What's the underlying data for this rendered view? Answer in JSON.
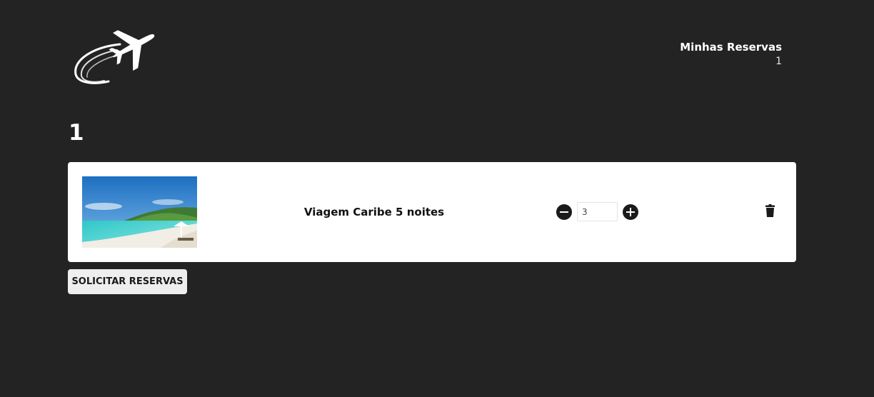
{
  "header": {
    "cart_title": "Minhas Reservas",
    "cart_count": "1"
  },
  "page": {
    "title": "1"
  },
  "products": [
    {
      "image": "caribbean-beach-photo",
      "name": "Viagem Caribe 5 noites",
      "quantity": "3"
    }
  ],
  "actions": {
    "submit_label": "SOLICITAR RESERVAS"
  },
  "icons": {
    "logo": "airplane-logo-icon",
    "decrement": "minus-circle-icon",
    "increment": "plus-circle-icon",
    "delete": "trash-icon"
  },
  "colors": {
    "background": "#232323",
    "card": "#ffffff",
    "button": "#eeeeee",
    "text_dark": "#111111",
    "text_light": "#ffffff"
  }
}
